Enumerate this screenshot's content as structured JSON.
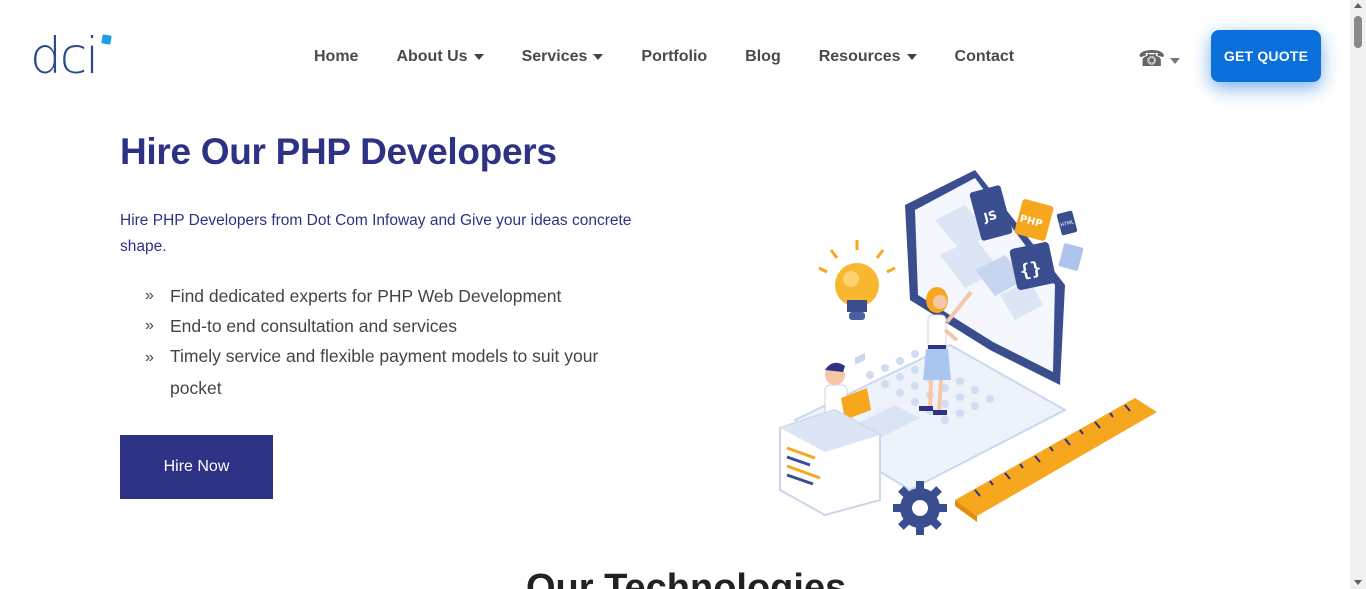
{
  "header": {
    "logo_text": "dci",
    "nav": [
      {
        "label": "Home",
        "dropdown": false
      },
      {
        "label": "About Us",
        "dropdown": true
      },
      {
        "label": "Services",
        "dropdown": true
      },
      {
        "label": "Portfolio",
        "dropdown": false
      },
      {
        "label": "Blog",
        "dropdown": false
      },
      {
        "label": "Resources",
        "dropdown": true
      },
      {
        "label": "Contact",
        "dropdown": false
      }
    ],
    "phone_icon": "☎",
    "quote_button": "GET QUOTE"
  },
  "hero": {
    "title": "Hire Our PHP Developers",
    "subtitle": "Hire PHP Developers from Dot Com Infoway and Give your ideas concrete shape.",
    "bullets": [
      "Find dedicated experts for PHP Web Development",
      "End-to end consultation and services",
      "Timely service and flexible payment models to suit your pocket"
    ],
    "bullet_icon": "»",
    "cta": "Hire Now"
  },
  "illustration": {
    "badges": [
      "JS",
      "PHP",
      "HTML",
      "{ }"
    ]
  },
  "next_section_peek": "Our Technologies",
  "colors": {
    "brand_navy": "#2e3285",
    "quote_blue": "#0b6fdc",
    "logo_blue": "#2b4a8b",
    "accent_orange": "#f7a71e"
  }
}
